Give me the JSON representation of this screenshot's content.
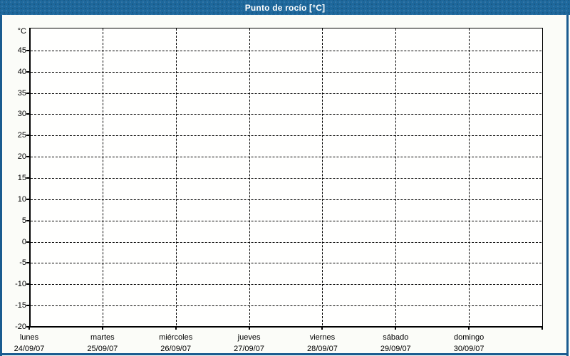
{
  "window": {
    "title": "Punto de rocío [°C]",
    "colors": {
      "header_bg": "#1e689c",
      "window_border": "#1a5c90",
      "title_text": "#ffffff",
      "content_bg": "#fbfcf8",
      "plot_bg": "#fffffe",
      "axis_and_grid": "#000000"
    }
  },
  "chart_data": {
    "type": "line",
    "title": "Punto de rocío [°C]",
    "xlabel": "",
    "ylabel": "°C",
    "ylim": [
      -20,
      50.35
    ],
    "y_tick_step": 5,
    "y_ticks": [
      45,
      40,
      35,
      30,
      25,
      20,
      15,
      10,
      5,
      0,
      -5,
      -10,
      -15,
      -20
    ],
    "x_ticks": [
      {
        "day": "lunes",
        "date": "24/09/07"
      },
      {
        "day": "martes",
        "date": "25/09/07"
      },
      {
        "day": "miércoles",
        "date": "26/09/07"
      },
      {
        "day": "jueves",
        "date": "27/09/07"
      },
      {
        "day": "viernes",
        "date": "28/09/07"
      },
      {
        "day": "sábado",
        "date": "29/09/07"
      },
      {
        "day": "domingo",
        "date": "30/09/07"
      }
    ],
    "x_divisions": 7,
    "series": [],
    "grid": "dashed-both-axes",
    "legend_position": "none"
  }
}
